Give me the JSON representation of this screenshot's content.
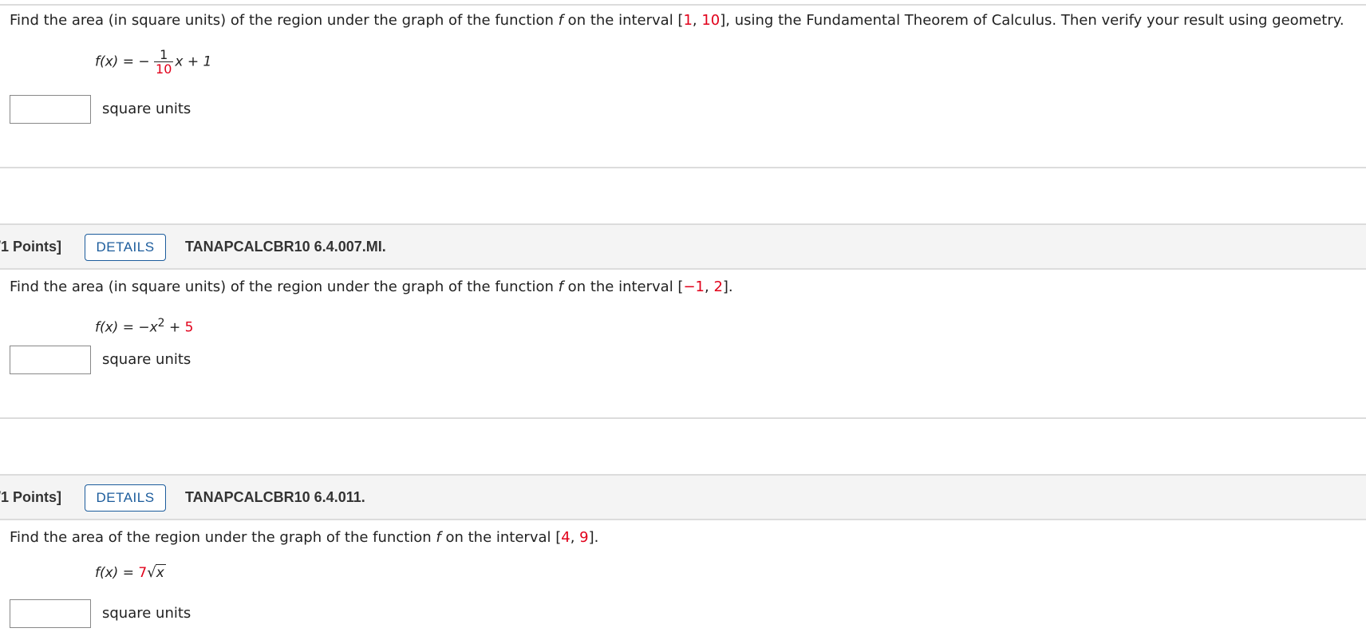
{
  "q1": {
    "prompt_a": "Find the area (in square units) of the region under the graph of the function ",
    "f": "f",
    "prompt_b": " on the interval [",
    "a": "1",
    "comma": ", ",
    "b": "10",
    "prompt_c": "], using the Fundamental Theorem of Calculus. Then verify your result using geometry.",
    "lhs": "f(x)",
    "eq": " = − ",
    "num": "1",
    "den": "10",
    "rest": "x + 1",
    "units": "square units"
  },
  "q2": {
    "points": "/1 Points]",
    "details": "DETAILS",
    "code": "TANAPCALCBR10 6.4.007.MI.",
    "prompt_a": "Find the area (in square units) of the region under the graph of the function ",
    "f": "f",
    "prompt_b": " on the interval [",
    "a": "−1",
    "comma": ", ",
    "b": "2",
    "prompt_c": "].",
    "lhs": "f(x)",
    "eq": " = −",
    "x": "x",
    "exp": "2",
    "plus": " + ",
    "c": "5",
    "units": "square units"
  },
  "q3": {
    "points": "/1 Points]",
    "details": "DETAILS",
    "code": "TANAPCALCBR10 6.4.011.",
    "prompt_a": "Find the area of the region under the graph of the function ",
    "f": "f",
    "prompt_b": " on the interval [",
    "a": "4",
    "comma": ", ",
    "b": "9",
    "prompt_c": "].",
    "lhs": "f(x)",
    "eq": " = ",
    "coef": "7",
    "radical": "√",
    "x": "x",
    "units": "square units"
  }
}
